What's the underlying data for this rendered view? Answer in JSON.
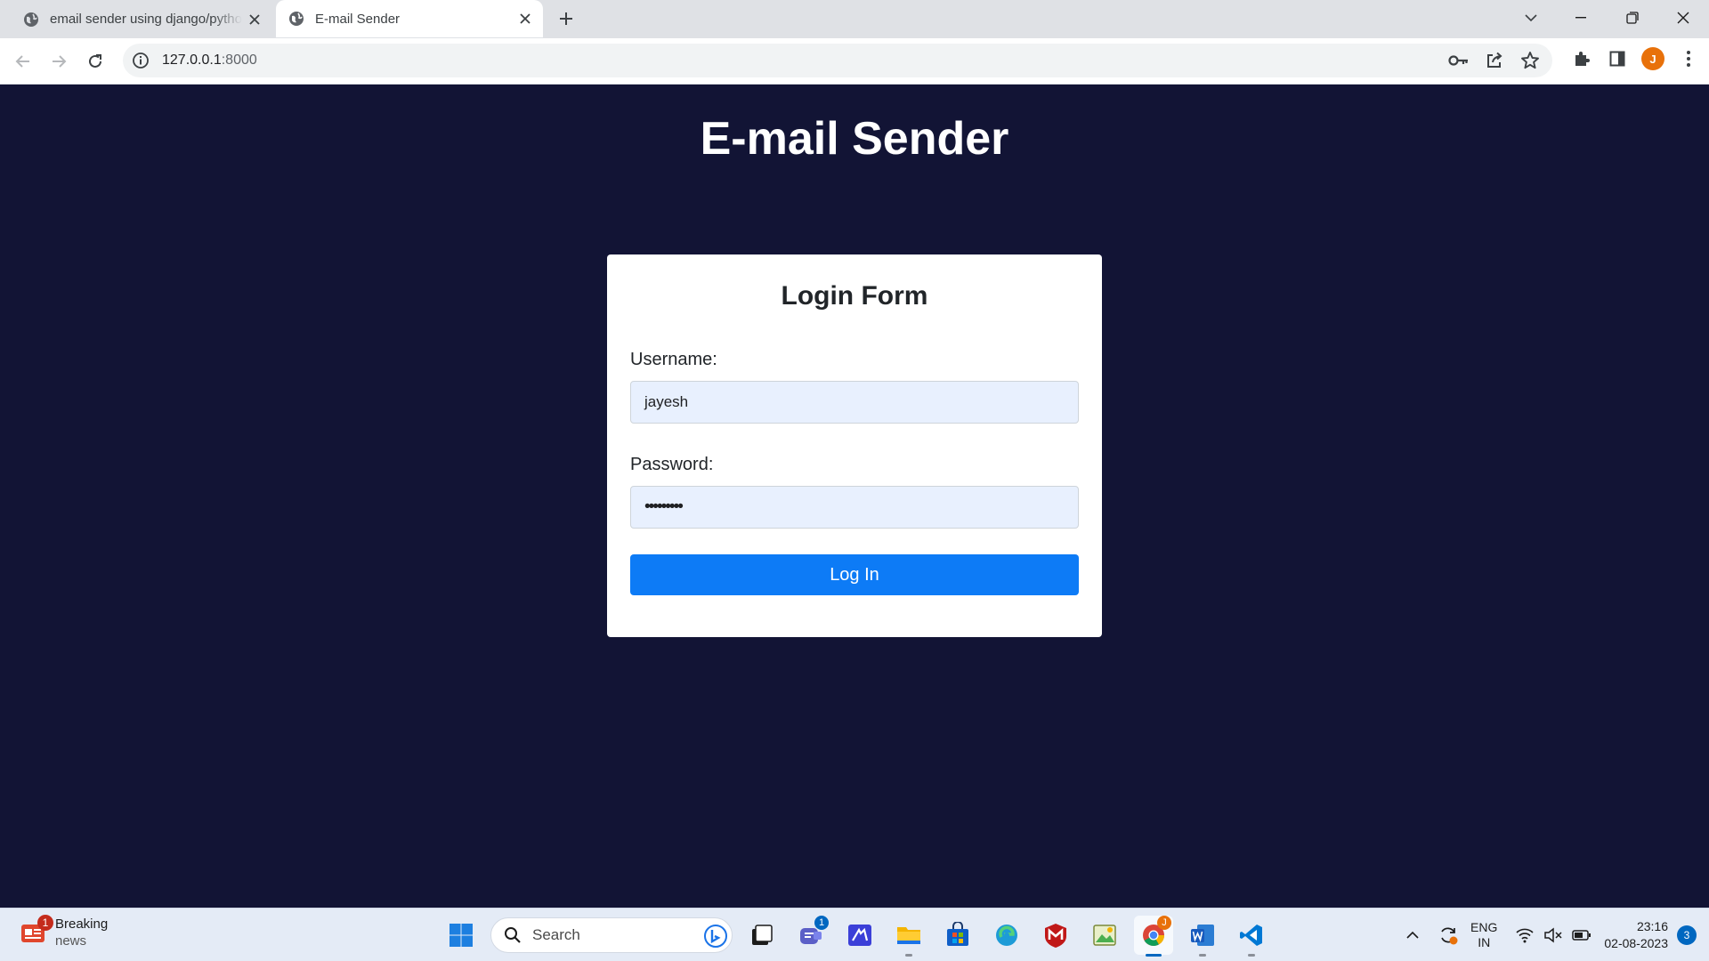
{
  "browser": {
    "tabs": [
      {
        "title": "email sender using django/pytho",
        "active": false
      },
      {
        "title": "E-mail Sender",
        "active": true
      }
    ],
    "address_bar": {
      "host": "127.0.0.1",
      "port": ":8000"
    },
    "profile_initial": "J",
    "accent_color": "#1a73e8"
  },
  "page": {
    "title": "E-mail Sender",
    "background_color": "#121435",
    "form": {
      "title": "Login Form",
      "username_label": "Username:",
      "username_value": "jayesh",
      "password_label": "Password:",
      "password_value": "•••••••••",
      "submit_label": "Log In",
      "button_color": "#0d7bf6",
      "input_autofill_color": "#e8f0fe"
    }
  },
  "taskbar": {
    "widget": {
      "title": "Breaking",
      "subtitle": "news",
      "badge": "1"
    },
    "search_placeholder": "Search",
    "teams_badge": "1",
    "chrome_badge": "J",
    "language": {
      "line1": "ENG",
      "line2": "IN"
    },
    "time": "23:16",
    "date": "02-08-2023",
    "notification_count": "3"
  }
}
